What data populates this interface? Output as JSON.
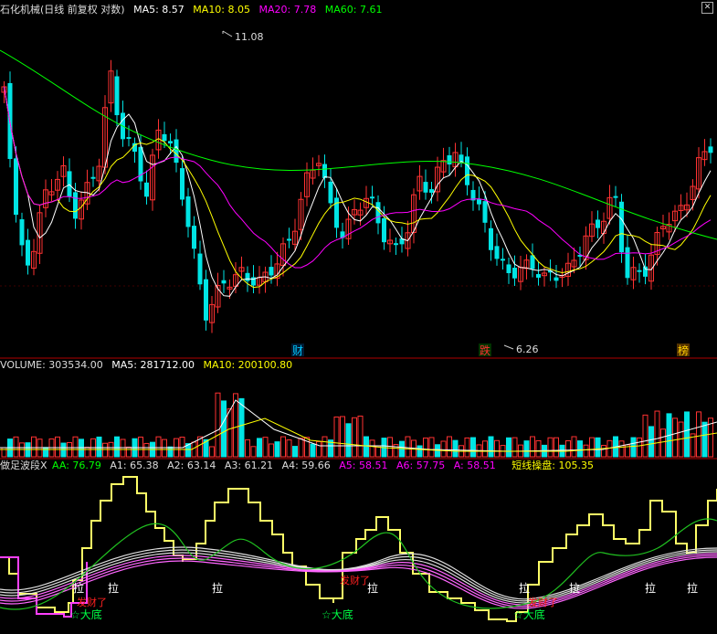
{
  "price_panel": {
    "title": "石化机械(日线 前复权 对数)",
    "ma5": "MA5: 8.57",
    "ma10": "MA10: 8.05",
    "ma20": "MA20: 7.78",
    "ma60": "MA60: 7.61",
    "high_label": "11.08",
    "low_label": "6.26",
    "event_markers": [
      "财",
      "跌",
      "榜"
    ]
  },
  "volume_panel": {
    "volume": "VOLUME: 303534.00",
    "ma5": "MA5: 281712.00",
    "ma10": "MA10: 200100.80"
  },
  "indicator_panel": {
    "name": "做足波段X",
    "aa": "AA: 76.79",
    "a1": "A1: 65.38",
    "a2": "A2: 63.14",
    "a3": "A3: 61.21",
    "a4": "A4: 59.66",
    "a5": "A5: 58.51",
    "a6": "A6: 57.75",
    "a": "A: 58.51",
    "short": "短线操盘: 105.35",
    "signals": [
      "拉",
      "拉",
      "拉",
      "拉",
      "拉",
      "拉",
      "拉",
      "拉"
    ],
    "bottom_labels": [
      "☆大底",
      "☆大底",
      "☆大底"
    ],
    "fortune_labels": [
      "发财了",
      "发财了",
      "发财了"
    ]
  },
  "colors": {
    "up": "#ff3232",
    "down": "#00e4e4",
    "ma5": "#ffffff",
    "ma10": "#ffff00",
    "ma20": "#ff00ff",
    "ma60": "#00ff00",
    "divider": "#b00000"
  }
}
